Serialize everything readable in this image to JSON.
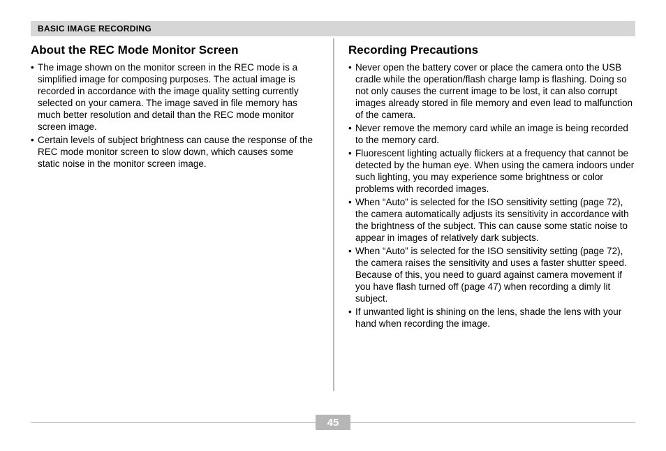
{
  "section_header": "BASIC IMAGE RECORDING",
  "page_number": "45",
  "left": {
    "heading": "About the REC Mode Monitor Screen",
    "bullets": [
      "The image shown on the monitor screen in the REC mode is a simplified image for composing purposes. The actual image is recorded in accordance with the image quality setting currently selected on your camera. The image saved in file memory has much better resolution and detail than the REC mode monitor screen image.",
      "Certain levels of subject brightness can cause the response of the REC mode monitor screen to slow down, which causes some static noise in the monitor screen image."
    ]
  },
  "right": {
    "heading": "Recording Precautions",
    "bullets": [
      "Never open the battery cover or place the camera onto the USB cradle while the operation/flash charge lamp is flashing. Doing so not only causes the current image to be lost, it can also corrupt images already stored in file memory and even lead to malfunction of the camera.",
      "Never remove the memory card while an image is being recorded to the memory card.",
      "Fluorescent lighting actually flickers at a frequency that cannot be detected by the human eye. When using the camera indoors under such lighting, you may experience some brightness or color problems with recorded images.",
      "When “Auto” is selected for the ISO sensitivity setting (page 72), the camera automatically adjusts its sensitivity in accordance with the brightness of the subject. This can cause some static noise to appear in images of relatively dark subjects.",
      "When “Auto” is selected for the ISO sensitivity setting (page 72), the camera raises the sensitivity and uses a faster shutter speed. Because of this, you need to guard against camera movement if you have flash turned off (page 47) when recording a dimly lit subject.",
      "If unwanted light is shining on the lens, shade the lens with your hand when recording the image."
    ]
  }
}
